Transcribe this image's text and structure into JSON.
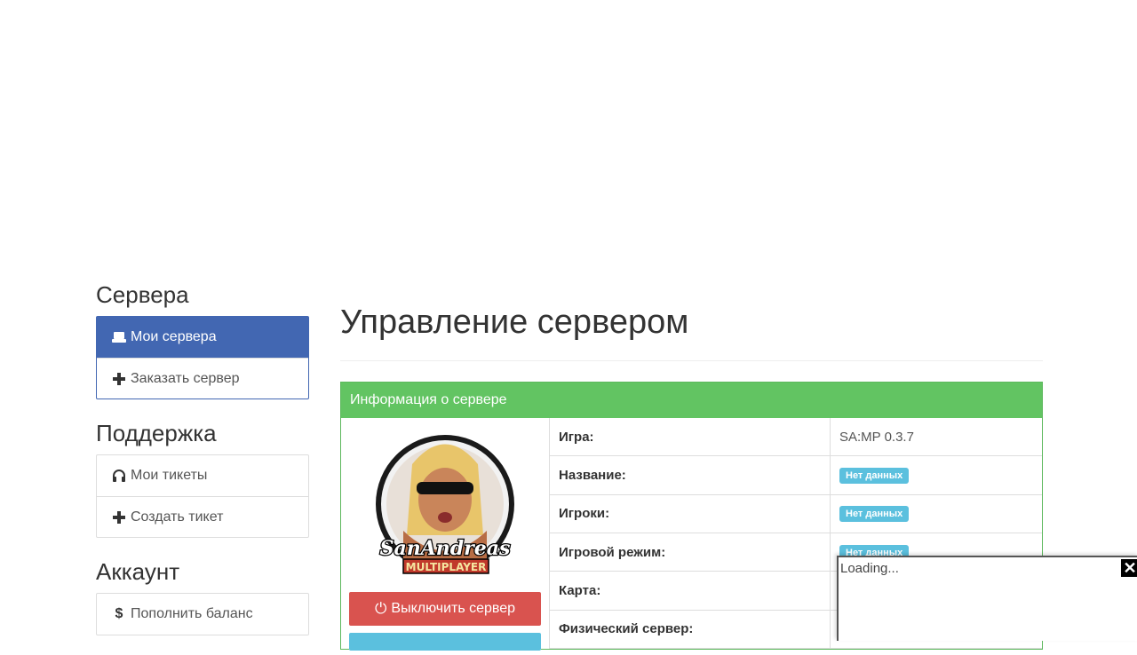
{
  "sidebar": {
    "servers_title": "Сервера",
    "servers_items": [
      {
        "label": "Мои сервера",
        "icon": "drive-icon",
        "active": true
      },
      {
        "label": "Заказать сервер",
        "icon": "plus-icon",
        "active": false
      }
    ],
    "support_title": "Поддержка",
    "support_items": [
      {
        "label": "Мои тикеты",
        "icon": "headphones-icon"
      },
      {
        "label": "Создать тикет",
        "icon": "plus-icon"
      }
    ],
    "account_title": "Аккаунт",
    "account_items": [
      {
        "label": "Пополнить баланс",
        "icon": "dollar-icon"
      }
    ]
  },
  "main": {
    "title": "Управление сервером",
    "panel": {
      "heading": "Информация о сервере",
      "stop_button": "Выключить сервер",
      "rows": [
        {
          "label": "Игра:",
          "value": "SA:MP 0.3.7",
          "badge": false
        },
        {
          "label": "Название:",
          "value": "Нет данных",
          "badge": true
        },
        {
          "label": "Игроки:",
          "value": "Нет данных",
          "badge": true
        },
        {
          "label": "Игровой режим:",
          "value": "Нет данных",
          "badge": true
        },
        {
          "label": "Карта:",
          "value": "",
          "badge": false
        },
        {
          "label": "Физический сервер:",
          "value": "",
          "badge": false
        }
      ]
    }
  },
  "popup": {
    "text": "Loading...",
    "close": "✕"
  },
  "colors": {
    "active_nav": "#4267b2",
    "panel_heading": "#62c462",
    "danger": "#d9534f",
    "info_badge": "#5bc0de"
  }
}
